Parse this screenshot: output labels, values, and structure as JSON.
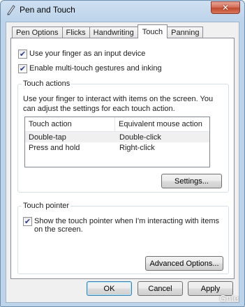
{
  "window": {
    "title": "Pen and Touch",
    "close_glyph": "✕"
  },
  "tabs": [
    {
      "label": "Pen Options"
    },
    {
      "label": "Flicks"
    },
    {
      "label": "Handwriting"
    },
    {
      "label": "Touch",
      "active": true
    },
    {
      "label": "Panning"
    }
  ],
  "options": {
    "use_finger": {
      "label": "Use your finger as an input device",
      "checked": true
    },
    "multi_touch": {
      "label": "Enable multi-touch gestures and inking",
      "checked": true
    }
  },
  "touch_actions": {
    "title": "Touch actions",
    "description": "Use your finger to interact with items on the screen. You can adjust the settings for each touch action.",
    "columns": [
      "Touch action",
      "Equivalent mouse action"
    ],
    "rows": [
      [
        "Double-tap",
        "Double-click"
      ],
      [
        "Press and hold",
        "Right-click"
      ]
    ],
    "settings_button": "Settings..."
  },
  "touch_pointer": {
    "title": "Touch pointer",
    "show_pointer": {
      "label": "Show the touch pointer when I'm interacting with items on the screen.",
      "checked": true
    },
    "advanced_button": "Advanced Options..."
  },
  "footer": {
    "ok": "OK",
    "cancel": "Cancel",
    "apply": "Apply"
  },
  "watermark": "Gnle",
  "check_glyph": "✔",
  "colors": {
    "titlebar": "#bcd3ea",
    "close_button": "#c24a2e",
    "accent": "#3c7fb1"
  }
}
